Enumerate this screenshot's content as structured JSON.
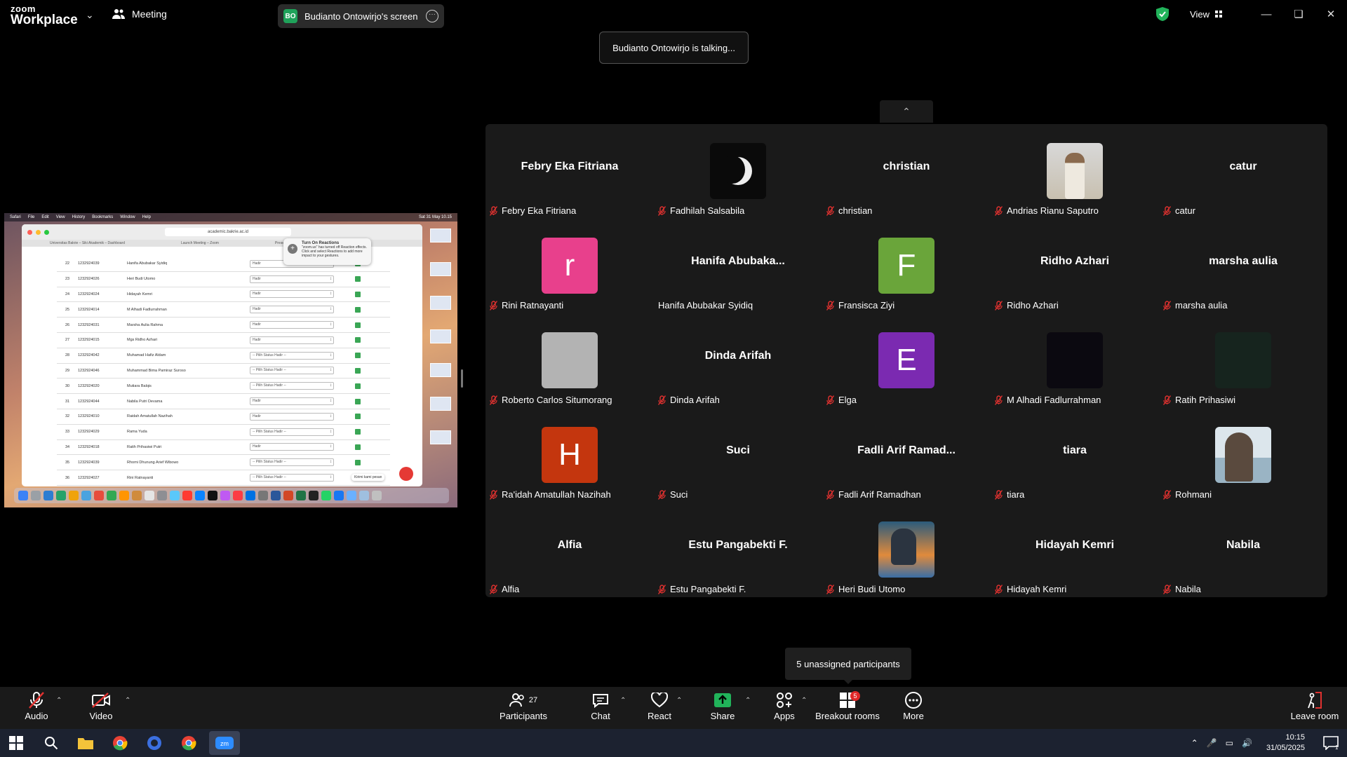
{
  "titlebar": {
    "logo_line1": "zoom",
    "logo_line2": "Workplace",
    "meeting_label": "Meeting",
    "share_initials": "BO",
    "share_label": "Budianto Ontowirjo's screen",
    "view_label": "View"
  },
  "talking": "Budianto Ontowirjo is talking...",
  "shared_screen": {
    "menubar": [
      "Safari",
      "File",
      "Edit",
      "View",
      "History",
      "Bookmarks",
      "Window",
      "Help"
    ],
    "menubar_clock": "Sat 31 May 10.15",
    "url": "academic.bakrie.ac.id",
    "tabs": [
      "Universitas Bakrie – Siki Akademik – Dashboard",
      "Launch Meeting – Zoom",
      "Presensi Kelas"
    ],
    "popup_title": "Turn On Reactions",
    "popup_body": "\"zoom.us\" has turned off Reaction effects. Click and select Reactions to add more impact to your gestures.",
    "rows": [
      {
        "no": "22",
        "nim": "1232924039",
        "name": "Hanifa Abubakar Syidiq",
        "status": "Hadir"
      },
      {
        "no": "23",
        "nim": "1232924026",
        "name": "Heri Budi Utomo",
        "status": "Hadir"
      },
      {
        "no": "24",
        "nim": "1232924024",
        "name": "Hidayah Kemri",
        "status": "Hadir"
      },
      {
        "no": "25",
        "nim": "1232924014",
        "name": "M Alhadi Fadlurrahman",
        "status": "Hadir"
      },
      {
        "no": "26",
        "nim": "1232924031",
        "name": "Marsha Aulia Rahma",
        "status": "Hadir"
      },
      {
        "no": "27",
        "nim": "1232924015",
        "name": "Mgs Ridho Azhari",
        "status": "Hadir"
      },
      {
        "no": "28",
        "nim": "1232924042",
        "name": "Muhamad Hafiz Aldam",
        "status": "-- Pilih Status Hadir --"
      },
      {
        "no": "29",
        "nim": "1232924046",
        "name": "Muhammad Bima Pamiraz Suroso",
        "status": "-- Pilih Status Hadir --"
      },
      {
        "no": "30",
        "nim": "1232924020",
        "name": "Mutiara Balqis",
        "status": "-- Pilih Status Hadir --"
      },
      {
        "no": "31",
        "nim": "1232924044",
        "name": "Nabila Putri Devama",
        "status": "Hadir"
      },
      {
        "no": "32",
        "nim": "1232924010",
        "name": "Raidah Amatullah Nazihah",
        "status": "Hadir"
      },
      {
        "no": "33",
        "nim": "1232924029",
        "name": "Rama Yuda",
        "status": "-- Pilih Status Hadir --"
      },
      {
        "no": "34",
        "nim": "1232924018",
        "name": "Ratih Prihasiwi Putri",
        "status": "Hadir"
      },
      {
        "no": "35",
        "nim": "1232924039",
        "name": "Rhomi Dhunung Arief Wibowo",
        "status": "-- Pilih Status Hadir --"
      },
      {
        "no": "36",
        "nim": "1232924027",
        "name": "Rini Ratnayanti",
        "status": "-- Pilih Status Hadir --"
      }
    ],
    "chat_tip": "Kirimi kami pesan"
  },
  "participants": [
    {
      "big": "Febry Eka Fitriana",
      "label": "Febry Eka Fitriana",
      "muted": true
    },
    {
      "avatar": "moon",
      "label": "Fadhilah Salsabila",
      "muted": true
    },
    {
      "big": "christian",
      "label": "christian",
      "muted": true
    },
    {
      "avatar": "photo-man",
      "label": "Andrias Rianu Saputro",
      "muted": true
    },
    {
      "big": "catur",
      "label": "catur",
      "muted": true
    },
    {
      "letter": "r",
      "color": "#e8408c",
      "label": "Rini Ratnayanti",
      "muted": true
    },
    {
      "big": "Hanifa  Abubaka...",
      "label": "Hanifa Abubakar Syidiq",
      "muted": false
    },
    {
      "letter": "F",
      "color": "#6aa53a",
      "label": "Fransisca Ziyi",
      "muted": true
    },
    {
      "big": "Ridho Azhari",
      "label": "Ridho Azhari",
      "muted": true
    },
    {
      "big": "marsha aulia",
      "label": "marsha aulia",
      "muted": true
    },
    {
      "avatar": "gray",
      "color": "#b3b3b3",
      "label": "Roberto Carlos Situmorang",
      "muted": true
    },
    {
      "big": "Dinda Arifah",
      "label": "Dinda Arifah",
      "muted": true
    },
    {
      "letter": "E",
      "color": "#7b2ab1",
      "label": "Elga",
      "muted": true
    },
    {
      "avatar": "dark",
      "color": "#0b0910",
      "label": "M Alhadi Fadlurrahman",
      "muted": true
    },
    {
      "avatar": "dark",
      "color": "#16241e",
      "label": "Ratih Prihasiwi",
      "muted": true
    },
    {
      "letter": "H",
      "color": "#c4360e",
      "label": "Ra'idah Amatullah Nazihah",
      "muted": true
    },
    {
      "big": "Suci",
      "label": "Suci",
      "muted": true
    },
    {
      "big": "Fadli  Arif  Ramad...",
      "label": "Fadli Arif Ramadhan",
      "muted": true
    },
    {
      "big": "tiara",
      "label": "tiara",
      "muted": true
    },
    {
      "avatar": "photo-beach",
      "label": "Rohmani",
      "muted": true
    },
    {
      "big": "Alfia",
      "label": "Alfia",
      "muted": true
    },
    {
      "big": "Estu Pangabekti F.",
      "label": "Estu Pangabekti F.",
      "muted": true
    },
    {
      "avatar": "photo-boat",
      "label": "Heri Budi Utomo",
      "muted": true
    },
    {
      "big": "Hidayah Kemri",
      "label": "Hidayah Kemri",
      "muted": true
    },
    {
      "big": "Nabila",
      "label": "Nabila",
      "muted": true
    }
  ],
  "unassigned": "5 unassigned participants",
  "toolbar": {
    "audio": "Audio",
    "video": "Video",
    "participants": "Participants",
    "participant_count": "27",
    "chat": "Chat",
    "react": "React",
    "share": "Share",
    "apps": "Apps",
    "breakout": "Breakout rooms",
    "breakout_badge": "5",
    "more": "More",
    "leave": "Leave room"
  },
  "taskbar": {
    "time": "10:15",
    "date": "31/05/2025",
    "notification_count": "1"
  },
  "colors": {
    "share_green": "#1fa25a",
    "mute_red": "#e0312f",
    "gallery_bg": "#1a1a1a"
  }
}
